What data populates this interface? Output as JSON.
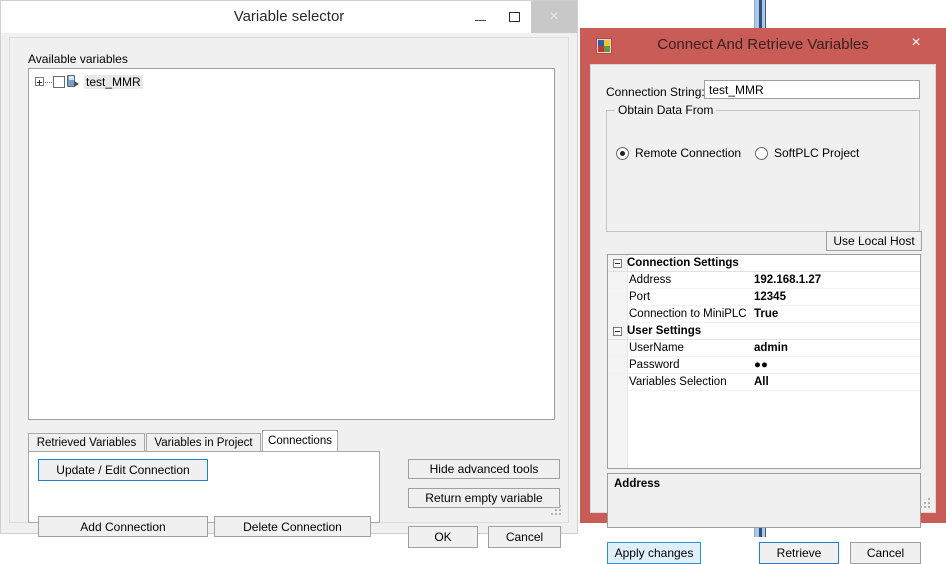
{
  "variable_selector": {
    "title": "Variable selector",
    "window_buttons": {
      "minimize": "minimize-icon",
      "maximize": "maximize-icon",
      "close": "×"
    },
    "available_label": "Available variables",
    "tree": {
      "nodes": [
        {
          "label": "test_MMR",
          "expander": "+",
          "checked": false,
          "icon": "remote-device-icon"
        }
      ]
    },
    "tabs": [
      {
        "label": "Retrieved Variables",
        "active": false
      },
      {
        "label": "Variables in Project",
        "active": false
      },
      {
        "label": "Connections",
        "active": true
      }
    ],
    "tab_buttons": {
      "update_edit": "Update / Edit Connection",
      "add": "Add Connection",
      "delete": "Delete Connection"
    },
    "side_buttons": {
      "hide_advanced": "Hide advanced tools",
      "return_empty": "Return empty variable",
      "ok": "OK",
      "cancel": "Cancel"
    }
  },
  "connect_dialog": {
    "title": "Connect And Retrieve Variables",
    "close_glyph": "×",
    "titlebar_color": "#c95c56",
    "connection_string": {
      "label": "Connection String:",
      "value": "test_MMR",
      "placeholder": ""
    },
    "obtain_data_from": {
      "legend": "Obtain Data From",
      "options": [
        {
          "label": "Remote Connection",
          "selected": true
        },
        {
          "label": "SoftPLC Project",
          "selected": false
        }
      ],
      "use_local_host": "Use Local Host"
    },
    "property_grid": {
      "categories": [
        {
          "name": "Connection Settings",
          "expanded": true,
          "rows": [
            {
              "name": "Address",
              "value": "192.168.1.27"
            },
            {
              "name": "Port",
              "value": "12345"
            },
            {
              "name": "Connection to MiniPLC",
              "value": "True"
            }
          ]
        },
        {
          "name": "User Settings",
          "expanded": true,
          "rows": [
            {
              "name": "UserName",
              "value": "admin"
            },
            {
              "name": "Password",
              "value": "●●"
            },
            {
              "name": "Variables Selection",
              "value": "All"
            }
          ]
        }
      ]
    },
    "description": {
      "title": "Address",
      "text": ""
    },
    "buttons": {
      "apply": "Apply changes",
      "retrieve": "Retrieve",
      "cancel": "Cancel"
    }
  }
}
